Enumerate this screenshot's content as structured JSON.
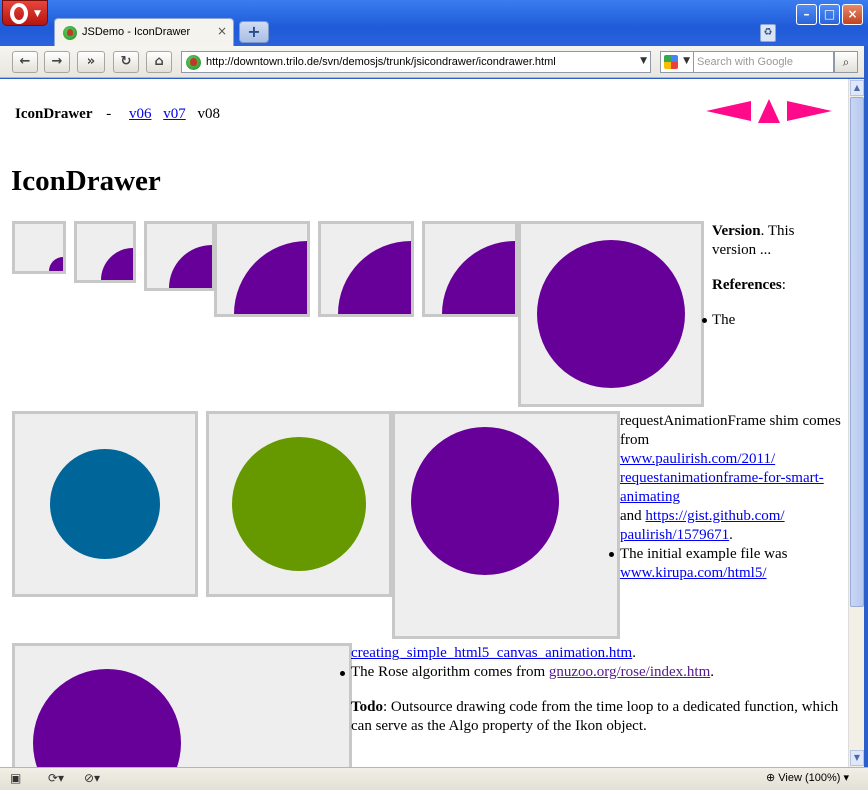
{
  "window": {
    "tab_title": "JSDemo - IconDrawer",
    "address_url": "http://downtown.trilo.de/svn/demosjs/trunk/jsicondrawer/icondrawer.html",
    "search_placeholder": "Search with Google",
    "zoom_label": "View (100%)"
  },
  "nav": {
    "brand": "IconDrawer",
    "separator": "-",
    "links": [
      "v06",
      "v07"
    ],
    "current": "v08"
  },
  "page": {
    "title": "IconDrawer"
  },
  "icons": {
    "colors": [
      "#660099",
      "#660099",
      "#660099",
      "#660099",
      "#660099",
      "#660099",
      "#660099",
      "#006699",
      "#669900",
      "#660099",
      "#660099"
    ],
    "background": "#eeeeee",
    "border": "#c8c8c8"
  },
  "sidebar": {
    "version_label": "Version",
    "version_text": ". This version ...",
    "references_label": "References",
    "references_colon": ":",
    "ref1_start": "The",
    "ref1_middle": "requestAnimationFrame shim comes from",
    "ref1_link1_line1": "www.paulirish.com/2011/",
    "ref1_link1_line2": "requestanimationframe-for-smart-",
    "ref1_link1_line3": "animating",
    "ref1_and": "and",
    "ref1_link2_line1": "https://gist.github.com/",
    "ref1_link2_line2": "paulirish/1579671",
    "ref1_end": ".",
    "ref2_text": "The initial example file was",
    "ref2_link_line1": "www.kirupa.com/html5/",
    "ref2_link_line2": "creating_simple_html5_canvas_animation.htm",
    "ref2_end": ".",
    "ref3_text": "The Rose algorithm comes from",
    "ref3_link": "gnuzoo.org/rose/index.htm",
    "ref3_end": ".",
    "todo_label": "Todo",
    "todo_text_line1": ": Outsource drawing code from the time loop to a dedicated function, which",
    "todo_text_line2": "can serve as the Algo property of the Ikon object."
  }
}
